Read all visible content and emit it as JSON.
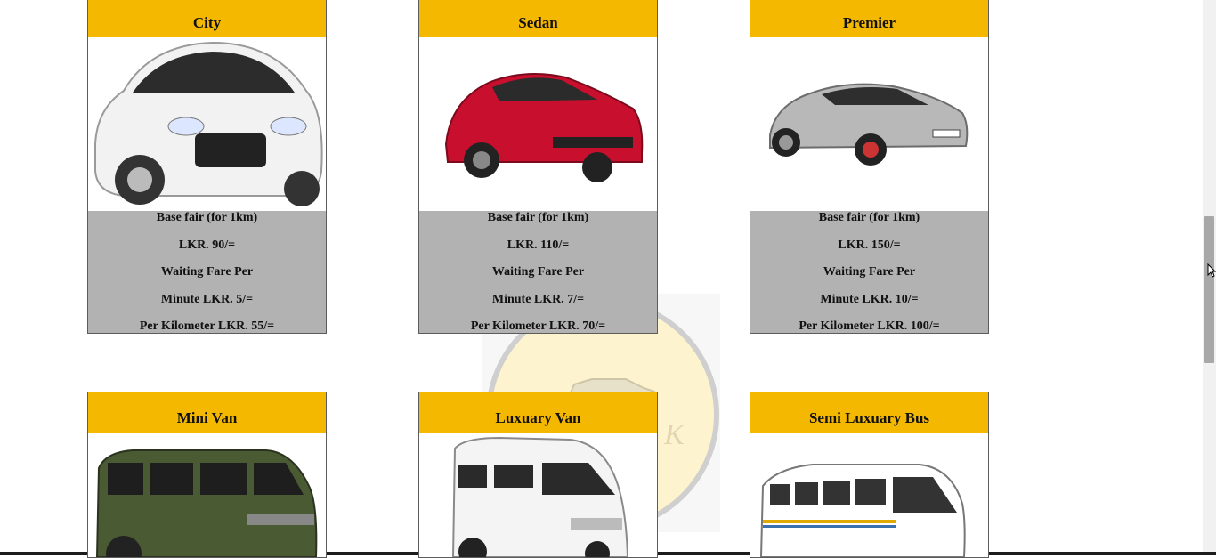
{
  "cards": [
    {
      "title": "City",
      "lines": [
        "Base fair (for 1km)",
        "LKR. 90/=",
        "Waiting Fare Per",
        "Minute LKR. 5/=",
        "Per Kilometer LKR. 55/="
      ]
    },
    {
      "title": "Sedan",
      "lines": [
        "Base fair (for 1km)",
        "LKR. 110/=",
        "Waiting Fare Per",
        "Minute LKR. 7/=",
        "Per Kilometer LKR. 70/="
      ]
    },
    {
      "title": "Premier",
      "lines": [
        "Base fair (for 1km)",
        "LKR. 150/=",
        "Waiting Fare Per",
        "Minute LKR. 10/=",
        "Per Kilometer LKR. 100/="
      ]
    },
    {
      "title": "Mini Van"
    },
    {
      "title": "Luxuary Van"
    },
    {
      "title": "Semi Luxuary Bus"
    }
  ],
  "watermark": {
    "letter": "K"
  },
  "colors": {
    "header": "#f5b800",
    "info": "#b2b2b2",
    "city_car": "#f2f2f2",
    "sedan_car": "#c8102e",
    "premier_car": "#b8b8b8",
    "minivan": "#4a5a32",
    "van": "#f4f4f4",
    "bus": "#ffffff"
  }
}
